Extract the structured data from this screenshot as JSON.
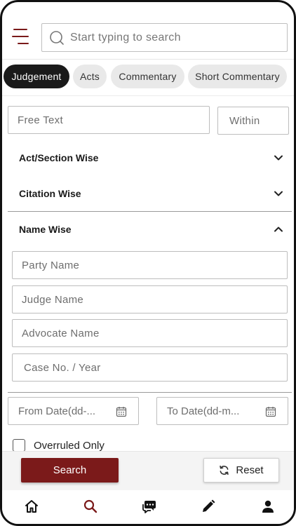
{
  "header": {
    "menu_icon": "hamburger-icon",
    "search_placeholder": "Start typing to search"
  },
  "tabs": [
    {
      "label": "Judgement",
      "active": true
    },
    {
      "label": "Acts",
      "active": false
    },
    {
      "label": "Commentary",
      "active": false
    },
    {
      "label": "Short Commentary",
      "active": false
    }
  ],
  "filters": {
    "free_text_placeholder": "Free Text",
    "within_placeholder": "Within",
    "sections": {
      "act_section": "Act/Section Wise",
      "citation": "Citation Wise",
      "name": "Name Wise"
    },
    "name_fields": {
      "party": "Party Name",
      "judge": "Judge Name",
      "advocate": "Advocate Name",
      "case_no": "Case No. / Year"
    },
    "from_date_placeholder": "From Date(dd-...",
    "to_date_placeholder": "To Date(dd-m...",
    "overruled_label": "Overruled Only"
  },
  "actions": {
    "search_label": "Search",
    "reset_label": "Reset"
  },
  "colors": {
    "brand": "#7b1a1a",
    "active_tab": "#1a1a1a",
    "tab_bg": "#e9e9e9"
  },
  "nav": [
    "home-icon",
    "search-icon",
    "chat-icon",
    "pencil-icon",
    "user-icon"
  ]
}
